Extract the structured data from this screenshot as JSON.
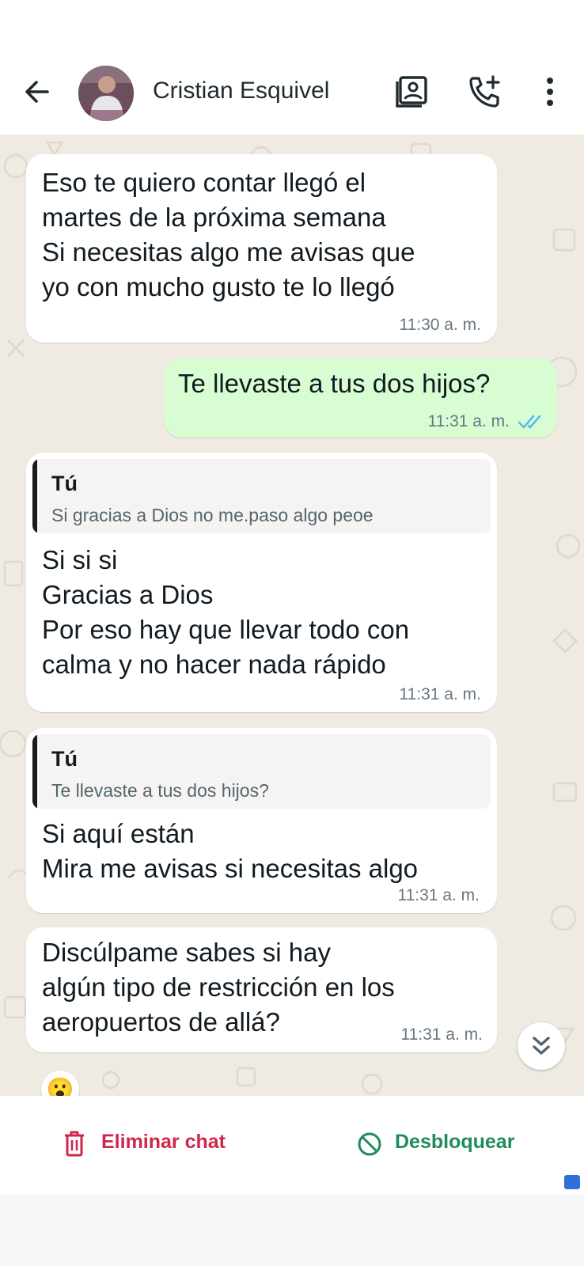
{
  "header": {
    "contact_name": "Cristian Esquivel",
    "icons": [
      "back-arrow-icon",
      "contact-card-icon",
      "add-call-icon",
      "more-vert-icon"
    ]
  },
  "messages": [
    {
      "direction": "in",
      "text": "Eso te quiero contar llegó el\nmartes de la próxima semana\nSi necesitas algo me avisas que\nyo con mucho gusto te lo llegó",
      "time": "11:30 a. m."
    },
    {
      "direction": "out",
      "text": "Te llevaste a tus dos hijos?",
      "time": "11:31 a. m.",
      "status": "read"
    },
    {
      "direction": "in",
      "quote": {
        "author": "Tú",
        "text": "Si gracias a Dios no me.paso algo peoe"
      },
      "text": "Si si si\nGracias a Dios\nPor eso hay que llevar todo con\ncalma y no hacer nada rápido",
      "time": "11:31 a. m."
    },
    {
      "direction": "in",
      "quote": {
        "author": "Tú",
        "text": "Te llevaste a tus dos hijos?"
      },
      "text": "Si aquí están\nMira me avisas si necesitas algo",
      "time": "11:31 a. m."
    },
    {
      "direction": "in",
      "text": "Discúlpame sabes si hay\nalgún tipo de restricción en los\naeropuertos de allá?",
      "time": "11:31 a. m.",
      "reaction": "😮"
    }
  ],
  "actions": {
    "delete_label": "Eliminar chat",
    "unblock_label": "Desbloquear"
  },
  "colors": {
    "chat_background": "#efeae2",
    "incoming_bubble": "#ffffff",
    "outgoing_bubble": "#d9fdd3",
    "delete_red": "#d1264b",
    "unblock_green": "#1f8a5c",
    "read_tick_blue": "#53bdeb"
  }
}
